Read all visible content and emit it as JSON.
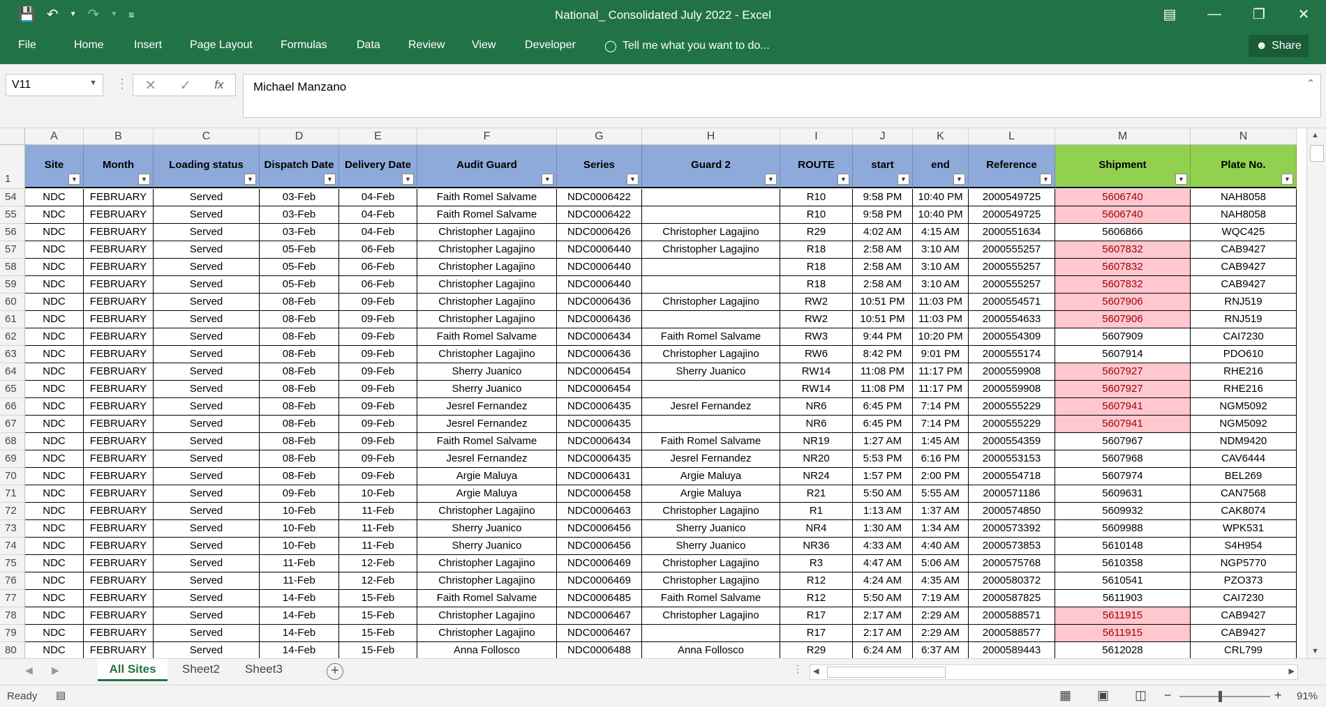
{
  "window": {
    "title": "National_ Consolidated July 2022 - Excel"
  },
  "ribbon": {
    "tabs": [
      "File",
      "Home",
      "Insert",
      "Page Layout",
      "Formulas",
      "Data",
      "Review",
      "View",
      "Developer"
    ],
    "tell_me": "Tell me what you want to do...",
    "share": "Share"
  },
  "formula_bar": {
    "name_box": "V11",
    "fx": "fx",
    "formula": "Michael Manzano"
  },
  "columns": [
    "A",
    "B",
    "C",
    "D",
    "E",
    "F",
    "G",
    "H",
    "I",
    "J",
    "K",
    "L",
    "M",
    "N"
  ],
  "header_row_number": "1",
  "headers": [
    "Site",
    "Month",
    "Loading status",
    "Dispatch Date",
    "Delivery Date",
    "Audit Guard",
    "Series",
    "Guard 2",
    "ROUTE",
    "start",
    "end",
    "Reference",
    "Shipment",
    "Plate No."
  ],
  "rows": [
    {
      "n": "54",
      "cells": [
        "NDC",
        "FEBRUARY",
        "Served",
        "03-Feb",
        "04-Feb",
        "Faith Romel Salvame",
        "NDC0006422",
        "",
        "R10",
        "9:58 PM",
        "10:40 PM",
        "2000549725",
        "5606740",
        "NAH8058"
      ],
      "dup": true
    },
    {
      "n": "55",
      "cells": [
        "NDC",
        "FEBRUARY",
        "Served",
        "03-Feb",
        "04-Feb",
        "Faith Romel Salvame",
        "NDC0006422",
        "",
        "R10",
        "9:58 PM",
        "10:40 PM",
        "2000549725",
        "5606740",
        "NAH8058"
      ],
      "dup": true
    },
    {
      "n": "56",
      "cells": [
        "NDC",
        "FEBRUARY",
        "Served",
        "03-Feb",
        "04-Feb",
        "Christopher Lagajino",
        "NDC0006426",
        "Christopher Lagajino",
        "R29",
        "4:02 AM",
        "4:15 AM",
        "2000551634",
        "5606866",
        "WQC425"
      ],
      "dup": false
    },
    {
      "n": "57",
      "cells": [
        "NDC",
        "FEBRUARY",
        "Served",
        "05-Feb",
        "06-Feb",
        "Christopher Lagajino",
        "NDC0006440",
        "Christopher Lagajino",
        "R18",
        "2:58 AM",
        "3:10 AM",
        "2000555257",
        "5607832",
        "CAB9427"
      ],
      "dup": true
    },
    {
      "n": "58",
      "cells": [
        "NDC",
        "FEBRUARY",
        "Served",
        "05-Feb",
        "06-Feb",
        "Christopher Lagajino",
        "NDC0006440",
        "",
        "R18",
        "2:58 AM",
        "3:10 AM",
        "2000555257",
        "5607832",
        "CAB9427"
      ],
      "dup": true
    },
    {
      "n": "59",
      "cells": [
        "NDC",
        "FEBRUARY",
        "Served",
        "05-Feb",
        "06-Feb",
        "Christopher Lagajino",
        "NDC0006440",
        "",
        "R18",
        "2:58 AM",
        "3:10 AM",
        "2000555257",
        "5607832",
        "CAB9427"
      ],
      "dup": true
    },
    {
      "n": "60",
      "cells": [
        "NDC",
        "FEBRUARY",
        "Served",
        "08-Feb",
        "09-Feb",
        "Christopher Lagajino",
        "NDC0006436",
        "Christopher Lagajino",
        "RW2",
        "10:51 PM",
        "11:03 PM",
        "2000554571",
        "5607906",
        "RNJ519"
      ],
      "dup": true
    },
    {
      "n": "61",
      "cells": [
        "NDC",
        "FEBRUARY",
        "Served",
        "08-Feb",
        "09-Feb",
        "Christopher Lagajino",
        "NDC0006436",
        "",
        "RW2",
        "10:51 PM",
        "11:03 PM",
        "2000554633",
        "5607906",
        "RNJ519"
      ],
      "dup": true
    },
    {
      "n": "62",
      "cells": [
        "NDC",
        "FEBRUARY",
        "Served",
        "08-Feb",
        "09-Feb",
        "Faith Romel Salvame",
        "NDC0006434",
        "Faith Romel Salvame",
        "RW3",
        "9:44 PM",
        "10:20 PM",
        "2000554309",
        "5607909",
        "CAI7230"
      ],
      "dup": false
    },
    {
      "n": "63",
      "cells": [
        "NDC",
        "FEBRUARY",
        "Served",
        "08-Feb",
        "09-Feb",
        "Christopher Lagajino",
        "NDC0006436",
        "Christopher Lagajino",
        "RW6",
        "8:42 PM",
        "9:01 PM",
        "2000555174",
        "5607914",
        "PDO610"
      ],
      "dup": false
    },
    {
      "n": "64",
      "cells": [
        "NDC",
        "FEBRUARY",
        "Served",
        "08-Feb",
        "09-Feb",
        "Sherry Juanico",
        "NDC0006454",
        "Sherry Juanico",
        "RW14",
        "11:08 PM",
        "11:17 PM",
        "2000559908",
        "5607927",
        "RHE216"
      ],
      "dup": true
    },
    {
      "n": "65",
      "cells": [
        "NDC",
        "FEBRUARY",
        "Served",
        "08-Feb",
        "09-Feb",
        "Sherry Juanico",
        "NDC0006454",
        "",
        "RW14",
        "11:08 PM",
        "11:17 PM",
        "2000559908",
        "5607927",
        "RHE216"
      ],
      "dup": true
    },
    {
      "n": "66",
      "cells": [
        "NDC",
        "FEBRUARY",
        "Served",
        "08-Feb",
        "09-Feb",
        "Jesrel Fernandez",
        "NDC0006435",
        "Jesrel Fernandez",
        "NR6",
        "6:45 PM",
        "7:14 PM",
        "2000555229",
        "5607941",
        "NGM5092"
      ],
      "dup": true
    },
    {
      "n": "67",
      "cells": [
        "NDC",
        "FEBRUARY",
        "Served",
        "08-Feb",
        "09-Feb",
        "Jesrel Fernandez",
        "NDC0006435",
        "",
        "NR6",
        "6:45 PM",
        "7:14 PM",
        "2000555229",
        "5607941",
        "NGM5092"
      ],
      "dup": true
    },
    {
      "n": "68",
      "cells": [
        "NDC",
        "FEBRUARY",
        "Served",
        "08-Feb",
        "09-Feb",
        "Faith Romel Salvame",
        "NDC0006434",
        "Faith Romel Salvame",
        "NR19",
        "1:27 AM",
        "1:45 AM",
        "2000554359",
        "5607967",
        "NDM9420"
      ],
      "dup": false
    },
    {
      "n": "69",
      "cells": [
        "NDC",
        "FEBRUARY",
        "Served",
        "08-Feb",
        "09-Feb",
        "Jesrel Fernandez",
        "NDC0006435",
        "Jesrel Fernandez",
        "NR20",
        "5:53 PM",
        "6:16 PM",
        "2000553153",
        "5607968",
        "CAV6444"
      ],
      "dup": false
    },
    {
      "n": "70",
      "cells": [
        "NDC",
        "FEBRUARY",
        "Served",
        "08-Feb",
        "09-Feb",
        "Argie Maluya",
        "NDC0006431",
        "Argie Maluya",
        "NR24",
        "1:57 PM",
        "2:00 PM",
        "2000554718",
        "5607974",
        "BEL269"
      ],
      "dup": false
    },
    {
      "n": "71",
      "cells": [
        "NDC",
        "FEBRUARY",
        "Served",
        "09-Feb",
        "10-Feb",
        "Argie Maluya",
        "NDC0006458",
        "Argie Maluya",
        "R21",
        "5:50 AM",
        "5:55 AM",
        "2000571186",
        "5609631",
        "CAN7568"
      ],
      "dup": false
    },
    {
      "n": "72",
      "cells": [
        "NDC",
        "FEBRUARY",
        "Served",
        "10-Feb",
        "11-Feb",
        "Christopher Lagajino",
        "NDC0006463",
        "Christopher Lagajino",
        "R1",
        "1:13 AM",
        "1:37 AM",
        "2000574850",
        "5609932",
        "CAK8074"
      ],
      "dup": false
    },
    {
      "n": "73",
      "cells": [
        "NDC",
        "FEBRUARY",
        "Served",
        "10-Feb",
        "11-Feb",
        "Sherry Juanico",
        "NDC0006456",
        "Sherry Juanico",
        "NR4",
        "1:30 AM",
        "1:34 AM",
        "2000573392",
        "5609988",
        "WPK531"
      ],
      "dup": false
    },
    {
      "n": "74",
      "cells": [
        "NDC",
        "FEBRUARY",
        "Served",
        "10-Feb",
        "11-Feb",
        "Sherry Juanico",
        "NDC0006456",
        "Sherry Juanico",
        "NR36",
        "4:33 AM",
        "4:40 AM",
        "2000573853",
        "5610148",
        "S4H954"
      ],
      "dup": false
    },
    {
      "n": "75",
      "cells": [
        "NDC",
        "FEBRUARY",
        "Served",
        "11-Feb",
        "12-Feb",
        "Christopher Lagajino",
        "NDC0006469",
        "Christopher Lagajino",
        "R3",
        "4:47 AM",
        "5:06 AM",
        "2000575768",
        "5610358",
        "NGP5770"
      ],
      "dup": false
    },
    {
      "n": "76",
      "cells": [
        "NDC",
        "FEBRUARY",
        "Served",
        "11-Feb",
        "12-Feb",
        "Christopher Lagajino",
        "NDC0006469",
        "Christopher Lagajino",
        "R12",
        "4:24 AM",
        "4:35 AM",
        "2000580372",
        "5610541",
        "PZO373"
      ],
      "dup": false
    },
    {
      "n": "77",
      "cells": [
        "NDC",
        "FEBRUARY",
        "Served",
        "14-Feb",
        "15-Feb",
        "Faith Romel Salvame",
        "NDC0006485",
        "Faith Romel Salvame",
        "R12",
        "5:50 AM",
        "7:19 AM",
        "2000587825",
        "5611903",
        "CAI7230"
      ],
      "dup": false
    },
    {
      "n": "78",
      "cells": [
        "NDC",
        "FEBRUARY",
        "Served",
        "14-Feb",
        "15-Feb",
        "Christopher Lagajino",
        "NDC0006467",
        "Christopher Lagajino",
        "R17",
        "2:17 AM",
        "2:29 AM",
        "2000588571",
        "5611915",
        "CAB9427"
      ],
      "dup": true
    },
    {
      "n": "79",
      "cells": [
        "NDC",
        "FEBRUARY",
        "Served",
        "14-Feb",
        "15-Feb",
        "Christopher Lagajino",
        "NDC0006467",
        "",
        "R17",
        "2:17 AM",
        "2:29 AM",
        "2000588577",
        "5611915",
        "CAB9427"
      ],
      "dup": true
    },
    {
      "n": "80",
      "cells": [
        "NDC",
        "FEBRUARY",
        "Served",
        "14-Feb",
        "15-Feb",
        "Anna Follosco",
        "NDC0006488",
        "Anna Follosco",
        "R29",
        "6:24 AM",
        "6:37 AM",
        "2000589443",
        "5612028",
        "CRL799"
      ],
      "dup": false
    }
  ],
  "sheets": [
    "All Sites",
    "Sheet2",
    "Sheet3"
  ],
  "active_sheet": "All Sites",
  "status": {
    "ready": "Ready",
    "zoom": "91%"
  },
  "colors": {
    "excel_green": "#217346",
    "header_blue": "#8eaadb",
    "header_green": "#92d050",
    "dup_fill": "#ffc7ce",
    "dup_text": "#9c0006"
  }
}
